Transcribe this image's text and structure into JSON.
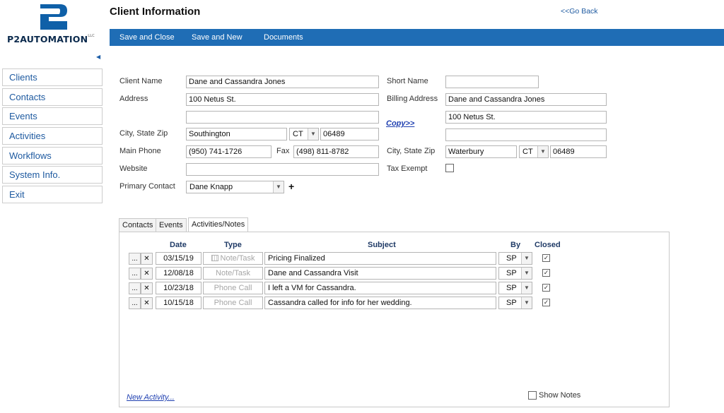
{
  "brand": {
    "name": "P2AUTOMATION",
    "trademark": "LLC",
    "color": "#0b2a4d"
  },
  "header": {
    "title": "Client Information",
    "go_back": "<<Go Back"
  },
  "toolbar": {
    "save_close": "Save and Close",
    "save_new": "Save and New",
    "documents": "Documents",
    "color": "#1f6db5"
  },
  "sidebar": {
    "collapse_icon": "caret-left-icon",
    "items": [
      {
        "label": "Clients"
      },
      {
        "label": "Contacts"
      },
      {
        "label": "Events"
      },
      {
        "label": "Activities"
      },
      {
        "label": "Workflows"
      },
      {
        "label": "System Info."
      },
      {
        "label": "Exit"
      }
    ]
  },
  "form": {
    "client_name": {
      "label": "Client Name",
      "value": "Dane and Cassandra Jones"
    },
    "address": {
      "label": "Address",
      "line1": "100 Netus St.",
      "line2": ""
    },
    "city_state_zip": {
      "label": "City, State Zip",
      "city": "Southington",
      "state": "CT",
      "zip": "06489"
    },
    "main_phone": {
      "label": "Main Phone",
      "value": "(950) 741-1726"
    },
    "fax": {
      "label": "Fax",
      "value": "(498) 811-8782"
    },
    "website": {
      "label": "Website",
      "value": ""
    },
    "primary_contact": {
      "label": "Primary Contact",
      "value": "Dane Knapp",
      "add_label": "+"
    },
    "short_name": {
      "label": "Short Name",
      "value": ""
    },
    "billing_address": {
      "label": "Billing Address",
      "name": "Dane and Cassandra Jones",
      "line1": "100 Netus St.",
      "line2": ""
    },
    "copy_link": "Copy>>",
    "billing_city_state_zip": {
      "label": "City, State Zip",
      "city": "Waterbury",
      "state": "CT",
      "zip": "06489"
    },
    "tax_exempt": {
      "label": "Tax Exempt",
      "checked": false
    }
  },
  "tabs": [
    {
      "label": "Contacts",
      "active": false
    },
    {
      "label": "Events",
      "active": false
    },
    {
      "label": "Activities/Notes",
      "active": true
    }
  ],
  "activities": {
    "columns": {
      "date": "Date",
      "type": "Type",
      "subject": "Subject",
      "by": "By",
      "closed": "Closed"
    },
    "more_label": "...",
    "delete_label": "✕",
    "check_mark": "✓",
    "rows": [
      {
        "date": "03/15/19",
        "type": "Note/Task",
        "subject": "Pricing Finalized",
        "by": "SP",
        "closed": true,
        "type_icon": "calendar-icon"
      },
      {
        "date": "12/08/18",
        "type": "Note/Task",
        "subject": "Dane and Cassandra Visit",
        "by": "SP",
        "closed": true
      },
      {
        "date": "10/23/18",
        "type": "Phone Call",
        "subject": "I left a VM for Cassandra.",
        "by": "SP",
        "closed": true
      },
      {
        "date": "10/15/18",
        "type": "Phone Call",
        "subject": "Cassandra called for info for her wedding.",
        "by": "SP",
        "closed": true
      }
    ],
    "new_activity": "New Activity...",
    "show_notes": {
      "label": "Show Notes",
      "checked": false
    }
  }
}
